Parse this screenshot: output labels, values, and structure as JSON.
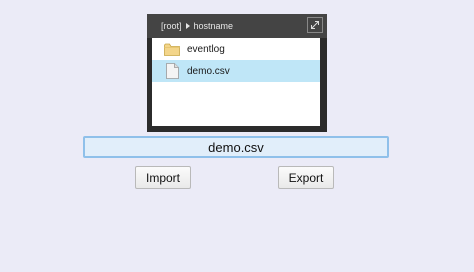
{
  "file_browser": {
    "breadcrumb": {
      "root": "[root]",
      "current": "hostname"
    },
    "items": [
      {
        "name": "eventlog",
        "type": "folder",
        "selected": false
      },
      {
        "name": "demo.csv",
        "type": "file",
        "selected": true
      }
    ]
  },
  "filename_input": {
    "value": "demo.csv"
  },
  "actions": {
    "import_label": "Import",
    "export_label": "Export"
  },
  "colors": {
    "background": "#ebebf7",
    "selection": "#bfe6f7",
    "input_border": "#8fc0ea",
    "folder": "#f3d58a"
  },
  "icons": {
    "expand": "expand-icon",
    "folder": "folder-icon",
    "file": "file-icon",
    "breadcrumb_separator": "caret-right-icon"
  }
}
